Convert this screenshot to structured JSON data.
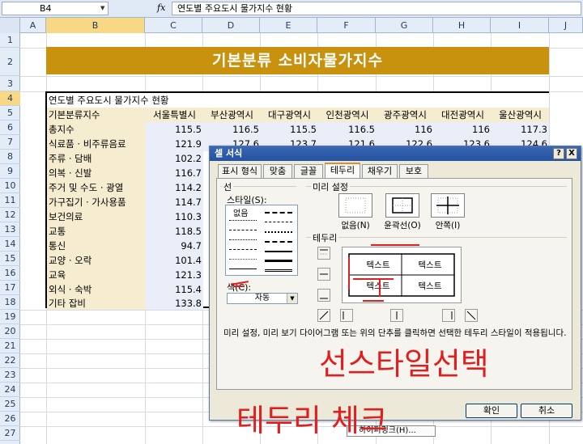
{
  "formula_bar": {
    "name_box": "B4",
    "fx_label": "fx",
    "content": "연도별 주요도시 물가지수 현황"
  },
  "columns": [
    "A",
    "B",
    "C",
    "D",
    "E",
    "F",
    "G",
    "H",
    "I",
    "J"
  ],
  "rows": [
    "1",
    "2",
    "3",
    "4",
    "5",
    "6",
    "7",
    "8",
    "9",
    "10",
    "11",
    "12",
    "13",
    "14",
    "15",
    "16",
    "17",
    "18",
    "19",
    "20",
    "21",
    "22",
    "23",
    "24",
    "25",
    "26",
    "27"
  ],
  "banner_title": "기본분류 소비자물가지수",
  "table": {
    "caption": "연도별 주요도시 물가지수 현황",
    "header": [
      "기본분류지수",
      "서울특별시",
      "부산광역시",
      "대구광역시",
      "인천광역시",
      "광주광역시",
      "대전광역시",
      "울산광역시"
    ],
    "labels": [
      "총지수",
      "식료품 · 비주류음료",
      "주류 · 담배",
      "의복 · 신발",
      "주거 및 수도 · 광열",
      "가구집기 · 가사용품",
      "보건의료",
      "교통",
      "통신",
      "교양 · 오락",
      "교육",
      "외식 · 숙박",
      "기타 잡비"
    ],
    "seoul": [
      "115.5",
      "121.9",
      "102.2",
      "116.7",
      "114.2",
      "114.7",
      "110.3",
      "118.5",
      "94.7",
      "101.4",
      "121.3",
      "115.4",
      "133.8"
    ],
    "row6_rest": [
      "116.5",
      "115.5",
      "116.5",
      "116",
      "116",
      "117.3"
    ],
    "row7_rest": [
      "127.6",
      "123.7",
      "121.6",
      "122.6",
      "123.6",
      "124.6"
    ]
  },
  "dialog": {
    "title": "셀 서식",
    "help": "?",
    "close": "X",
    "tabs": [
      "표시 형식",
      "맞춤",
      "글꼴",
      "테두리",
      "채우기",
      "보호"
    ],
    "active_tab": "테두리",
    "line_group": "선",
    "style_label": "스타일(S):",
    "style_none": "없음",
    "color_label": "색(C):",
    "color_value": "자동",
    "preset_group": "미리 설정",
    "presets": [
      "없음(N)",
      "윤곽선(O)",
      "안쪽(I)"
    ],
    "border_group": "테두리",
    "preview_text": [
      "텍스트",
      "텍스트",
      "텍스트",
      "텍스트"
    ],
    "hint": "미리 설정, 미리 보기 다이어그램 또는 위의 단추를 클릭하면 선택한 테두리 스타일이 적용됩니다.",
    "ok": "확인",
    "cancel": "취소"
  },
  "annotations": {
    "select_style": "선스타일선택",
    "check_border": "테두리 체크"
  },
  "menu_fragment": "하이퍼링크(H)...",
  "colors": {
    "banner": "#c8920e",
    "label_fill": "#f6ecd0",
    "value_fill": "#e9eef8",
    "annotation": "#e02020",
    "dialog_title": "#2452a0"
  }
}
